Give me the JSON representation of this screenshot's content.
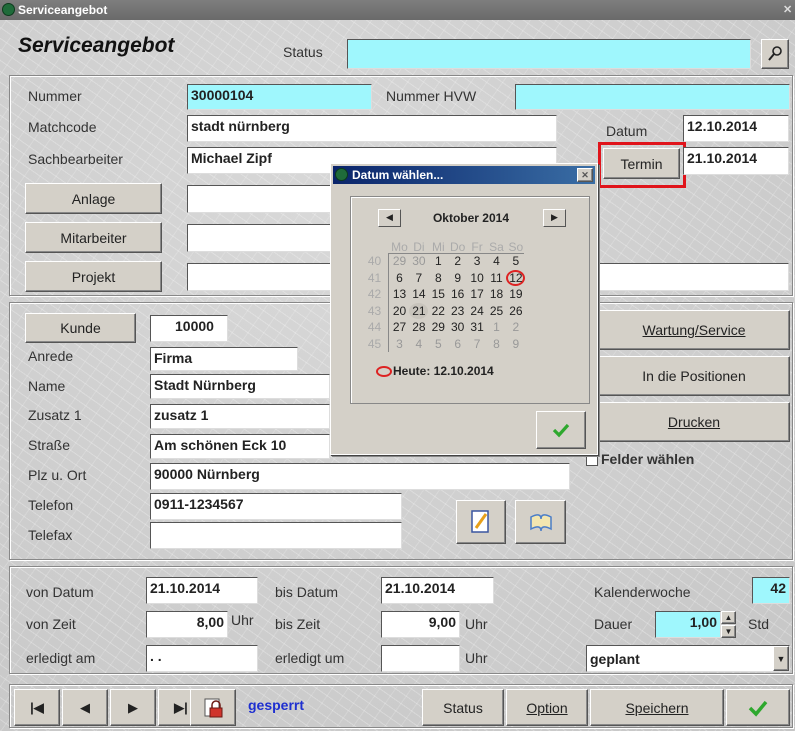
{
  "window": {
    "title": "Serviceangebot"
  },
  "header": {
    "title": "Serviceangebot",
    "status_label": "Status",
    "status_value": ""
  },
  "top": {
    "nummer_label": "Nummer",
    "nummer_value": "30000104",
    "nummer_hvw_label": "Nummer HVW",
    "nummer_hvw_value": "",
    "matchcode_label": "Matchcode",
    "matchcode_value": "stadt nürnberg",
    "sachbearbeiter_label": "Sachbearbeiter",
    "sachbearbeiter_value": "Michael Zipf",
    "datum_label": "Datum",
    "datum_value": "12.10.2014",
    "termin_label": "Termin",
    "termin_value": "21.10.2014",
    "anlage_label": "Anlage",
    "mitarbeiter_label": "Mitarbeiter",
    "projekt_label": "Projekt"
  },
  "customer": {
    "kunde_label": "Kunde",
    "kunde_value": "10000",
    "anrede_label": "Anrede",
    "anrede_value": "Firma",
    "name_label": "Name",
    "name_value": "Stadt Nürnberg",
    "zusatz_label": "Zusatz 1",
    "zusatz_value": "zusatz 1",
    "strasse_label": "Straße",
    "strasse_value": "Am schönen Eck 10",
    "plz_label": "Plz u. Ort",
    "plz_value": "90000 Nürnberg",
    "telefon_label": "Telefon",
    "telefon_value": "0911-1234567",
    "telefax_label": "Telefax",
    "telefax_value": "",
    "wartung_label": "Wartung/Service",
    "positionen_label": "In die Positionen",
    "drucken_label": "Drucken",
    "felder_label": "Felder wählen"
  },
  "schedule": {
    "von_datum_label": "von Datum",
    "von_datum_value": "21.10.2014",
    "bis_datum_label": "bis Datum",
    "bis_datum_value": "21.10.2014",
    "kw_label": "Kalenderwoche",
    "kw_value": "42",
    "von_zeit_label": "von Zeit",
    "von_zeit_value": "8,00",
    "uhr1": "Uhr",
    "bis_zeit_label": "bis Zeit",
    "bis_zeit_value": "9,00",
    "uhr2": "Uhr",
    "dauer_label": "Dauer",
    "dauer_value": "1,00",
    "std": "Std",
    "erledigt_am_label": "erledigt am",
    "erledigt_am_value": ". .",
    "erledigt_um_label": "erledigt um",
    "erledigt_um_value": "",
    "uhr3": "Uhr",
    "status_select": "geplant"
  },
  "toolbar": {
    "gesperrt": "gesperrt",
    "status_label": "Status",
    "option_label": "Option",
    "speichern_label": "Speichern"
  },
  "dialog": {
    "title": "Datum wählen...",
    "month": "Oktober 2014",
    "weekdays": [
      "Mo",
      "Di",
      "Mi",
      "Do",
      "Fr",
      "Sa",
      "So"
    ],
    "weeks": [
      "40",
      "41",
      "42",
      "43",
      "44",
      "45"
    ],
    "days": [
      [
        "29",
        "30",
        "1",
        "2",
        "3",
        "4",
        "5"
      ],
      [
        "6",
        "7",
        "8",
        "9",
        "10",
        "11",
        "12"
      ],
      [
        "13",
        "14",
        "15",
        "16",
        "17",
        "18",
        "19"
      ],
      [
        "20",
        "21",
        "22",
        "23",
        "24",
        "25",
        "26"
      ],
      [
        "27",
        "28",
        "29",
        "30",
        "31",
        "1",
        "2"
      ],
      [
        "3",
        "4",
        "5",
        "6",
        "7",
        "8",
        "9"
      ]
    ],
    "today_label": "Heute: 12.10.2014"
  },
  "colors": {
    "cyan": "#9ff7fd",
    "highlight": "#e0141b",
    "check": "#2ea82e",
    "gesperrt": "#1e2fd0"
  }
}
